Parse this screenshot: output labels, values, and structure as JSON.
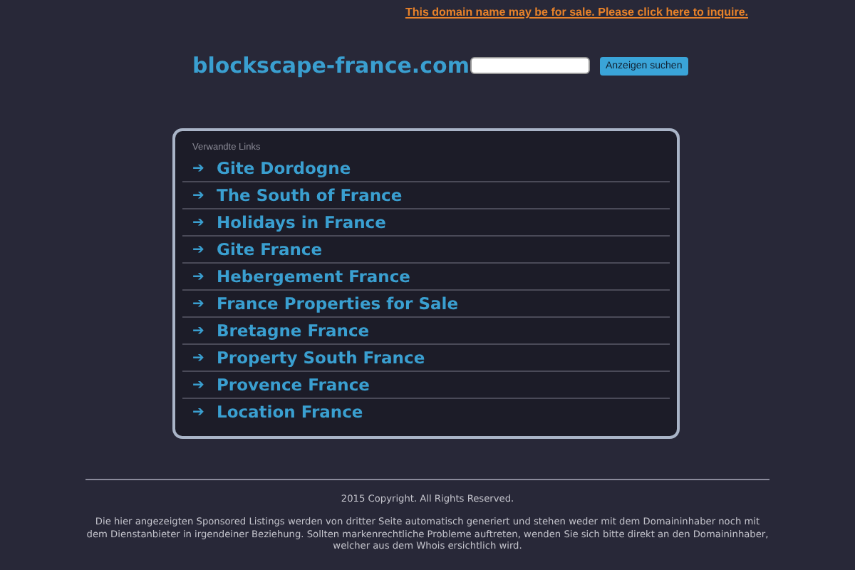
{
  "sale_notice": "This domain name may be for sale. Please click here to inquire.",
  "header": {
    "domain": "blockscape-france.com",
    "search_button": "Anzeigen suchen"
  },
  "links_panel": {
    "heading": "Verwandte Links",
    "links": [
      {
        "arrow": "➔",
        "label": "Gite Dordogne"
      },
      {
        "arrow": "➔",
        "label": "The South of France"
      },
      {
        "arrow": "➔",
        "label": "Holidays in France"
      },
      {
        "arrow": "➔",
        "label": "Gite France"
      },
      {
        "arrow": "➔",
        "label": "Hebergement France"
      },
      {
        "arrow": "➔",
        "label": "France Properties for Sale"
      },
      {
        "arrow": "➔",
        "label": "Bretagne France"
      },
      {
        "arrow": "➔",
        "label": "Property South France"
      },
      {
        "arrow": "➔",
        "label": "Provence France"
      },
      {
        "arrow": "➔",
        "label": "Location France"
      }
    ]
  },
  "footer": {
    "copyright": "2015 Copyright. All Rights Reserved.",
    "disclaimer": "Die hier angezeigten Sponsored Listings werden von dritter Seite automatisch generiert und stehen weder mit dem Domaininhaber noch mit dem Dienstanbieter in irgendeiner Beziehung. Sollten markenrechtliche Probleme auftreten, wenden Sie sich bitte direkt an den Domaininhaber, welcher aus dem Whois ersichtlich wird."
  }
}
